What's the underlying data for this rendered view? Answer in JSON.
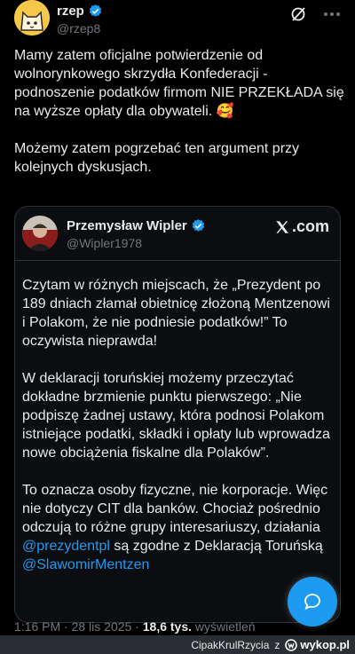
{
  "author": {
    "name": "rzep",
    "handle": "@rzep8"
  },
  "tweet": {
    "paragraphs": [
      "Mamy zatem oficjalne potwierdzenie od wolnorynkowego skrzydła Konfederacji - podnoszenie podatków firmom NIE PRZEKŁADA się na wyższe opłaty dla obywateli. 🥰",
      "Możemy zatem pogrzebać ten argument przy kolejnych dyskusjach."
    ]
  },
  "quote": {
    "name": "Przemysław Wipler",
    "handle": "@Wipler1978",
    "source": ".com",
    "paragraphs": [
      "Czytam w różnych miejscach, że „Prezydent po 189 dniach złamał obietnicę złożoną Mentzenowi i Polakom, że nie podniesie podatków!” To oczywista nieprawda!",
      "W deklaracji toruńskiej możemy przeczytać dokładne brzmienie punktu pierwszego:  „Nie podpiszę żadnej ustawy, która podnosi Polakom istniejące podatki, składki i opłaty lub wprowadza nowe obciążenia fiskalne dla Polaków”."
    ],
    "p3_text": "To oznacza osoby fizyczne, nie korporacje. Więc nie dotyczy CIT dla banków. Chociaż pośrednio odczują to różne grupy interesariuszy, działania ",
    "mention1": "@prezydentpl",
    "p3_mid": " są zgodne z Deklaracją Toruńską ",
    "mention2": "@SlawomirMentzen"
  },
  "meta": {
    "time": "1:16 PM · 28 lis 2025 · ",
    "views": "18,6 tys.",
    "views_label": " wyświetleń"
  },
  "footer": {
    "user": "CipakKrulRzycia",
    "sep": "z",
    "site": "wykop.pl"
  },
  "colors": {
    "background": "#000000",
    "text": "#e7e9ea",
    "muted": "#71767b",
    "accent": "#1d9bf0"
  }
}
